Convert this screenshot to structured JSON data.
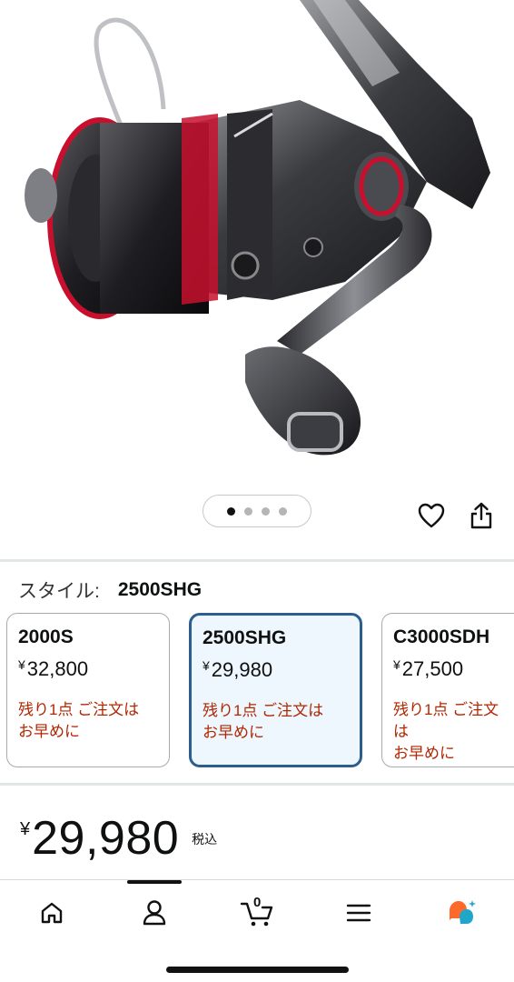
{
  "product": {
    "image_alt": "Spinning reel",
    "carousel": {
      "dot_count": 4,
      "active_index": 0
    }
  },
  "actions": {
    "wishlist_icon": "heart-icon",
    "share_icon": "share-icon"
  },
  "style_selector": {
    "label": "スタイル:",
    "selected_value": "2500SHG"
  },
  "variants": [
    {
      "name": "2000S",
      "currency": "¥",
      "price": "32,800",
      "stock_line1": "残り1点 ご注文は",
      "stock_line2": "お早めに",
      "selected": false
    },
    {
      "name": "2500SHG",
      "currency": "¥",
      "price": "29,980",
      "stock_line1": "残り1点 ご注文は",
      "stock_line2": "お早めに",
      "selected": true
    },
    {
      "name": "C3000SDH",
      "currency": "¥",
      "price": "27,500",
      "stock_line1": "残り1点 ご注文は",
      "stock_line2": "お早めに",
      "selected": false
    }
  ],
  "price_block": {
    "currency": "¥",
    "amount": "29,980",
    "tax_note": "税込"
  },
  "bottom_nav": {
    "items": [
      "home-icon",
      "account-icon",
      "cart-icon",
      "menu-icon",
      "ai-assistant-icon"
    ],
    "cart_count": "0",
    "active_index": 1
  },
  "colors": {
    "accent_red": "#b12704",
    "selected_border": "#2b5d8f",
    "selected_bg": "#edf7fd",
    "reel_red": "#c8102e"
  }
}
